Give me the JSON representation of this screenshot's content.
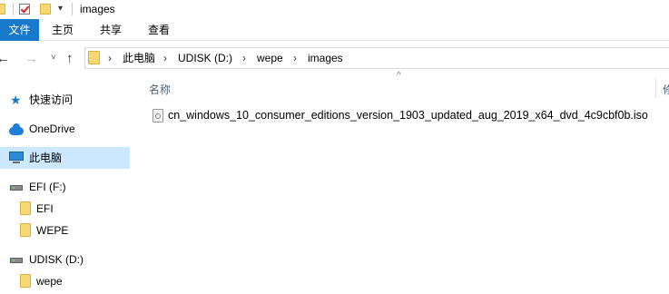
{
  "titlebar": {
    "title": "images"
  },
  "ribbon": {
    "tabs": [
      "文件",
      "主页",
      "共享",
      "查看"
    ]
  },
  "nav": {
    "back": "←",
    "forward": "→",
    "up": "↑",
    "recent": "˅"
  },
  "address": {
    "crumbs": [
      "此电脑",
      "UDISK (D:)",
      "wepe",
      "images"
    ],
    "separator": "›"
  },
  "sidebar": {
    "items": [
      {
        "label": "快速访问",
        "icon": "star-icon"
      },
      {
        "label": "OneDrive",
        "icon": "cloud-icon"
      },
      {
        "label": "此电脑",
        "icon": "computer-icon",
        "selected": true
      },
      {
        "label": "EFI (F:)",
        "icon": "drive-icon"
      },
      {
        "label": "EFI",
        "icon": "folder-icon"
      },
      {
        "label": "WEPE",
        "icon": "folder-icon"
      },
      {
        "label": "UDISK (D:)",
        "icon": "drive-icon"
      },
      {
        "label": "wepe",
        "icon": "folder-icon"
      }
    ]
  },
  "content": {
    "columns": [
      "名称",
      "修"
    ],
    "sort_indicator": "^",
    "files": [
      {
        "name": "cn_windows_10_consumer_editions_version_1903_updated_aug_2019_x64_dvd_4c9cbf0b.iso",
        "icon": "disc-image-file-icon"
      }
    ]
  },
  "colors": {
    "accent": "#1979ca",
    "selected": "#cce8ff",
    "folder": "#f8d775"
  }
}
